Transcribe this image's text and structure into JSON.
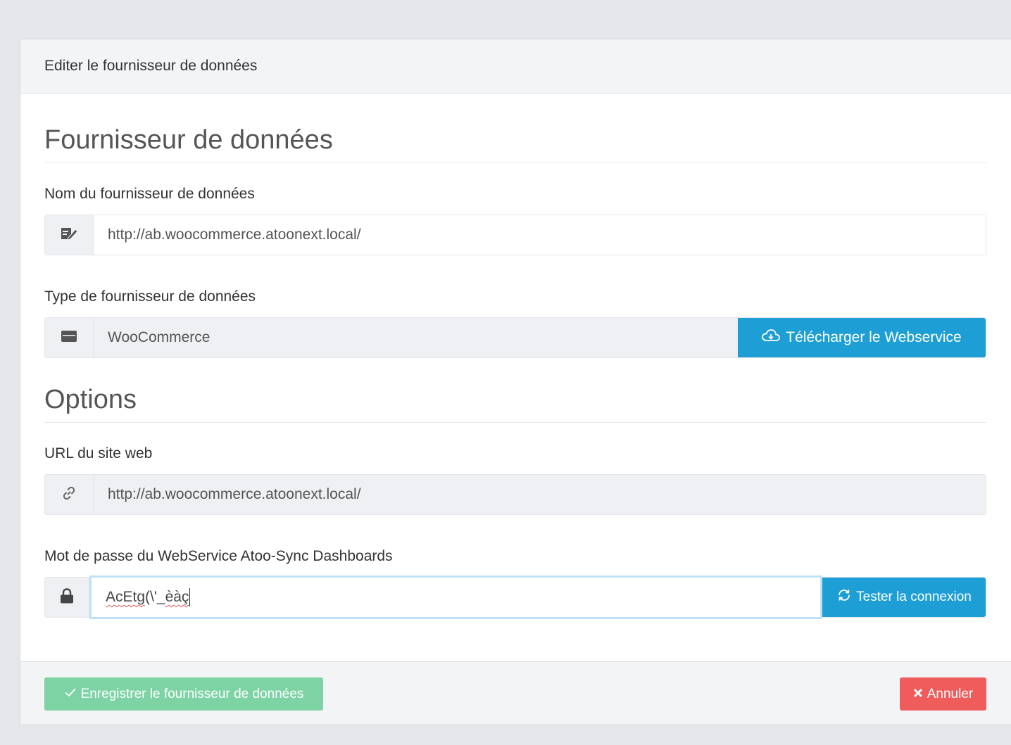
{
  "card": {
    "header_title": "Editer le fournisseur de données"
  },
  "section_provider": {
    "title": "Fournisseur de données",
    "name_label": "Nom du fournisseur de données",
    "name_value": "http://ab.woocommerce.atoonext.local/",
    "name_icon": "edit-icon",
    "type_label": "Type de fournisseur de données",
    "type_value": "WooCommerce",
    "type_icon": "server-icon",
    "download_button": "Télécharger le Webservice",
    "download_icon": "cloud-download-icon"
  },
  "section_options": {
    "title": "Options",
    "url_label": "URL du site web",
    "url_value": "http://ab.woocommerce.atoonext.local/",
    "url_icon": "link-icon",
    "password_label": "Mot de passe du WebService Atoo-Sync Dashboards",
    "password_value_part1": "AcEtg",
    "password_value_part2": "(\\'_",
    "password_value_part3": "èàç",
    "password_icon": "lock-icon",
    "test_button": "Tester la connexion",
    "test_icon": "refresh-icon"
  },
  "footer": {
    "save_button": "Enregistrer le fournisseur de données",
    "save_icon": "check-icon",
    "cancel_button": "Annuler",
    "cancel_icon": "close-icon"
  },
  "colors": {
    "info": "#1d9fd6",
    "success_disabled": "#7dd3a4",
    "danger": "#f05b5b",
    "background": "#e5e6e9"
  }
}
